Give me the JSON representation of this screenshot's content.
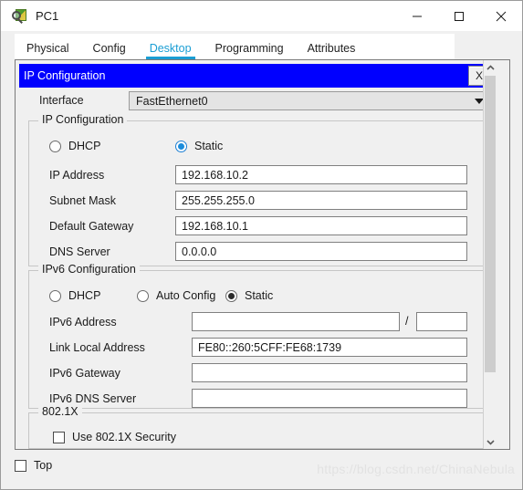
{
  "window": {
    "title": "PC1",
    "icon": "packet-tracer-icon",
    "controls": {
      "minimize": "minimize-icon",
      "maximize": "maximize-icon",
      "close": "close-icon"
    }
  },
  "tabs": [
    {
      "label": "Physical",
      "active": false
    },
    {
      "label": "Config",
      "active": false
    },
    {
      "label": "Desktop",
      "active": true
    },
    {
      "label": "Programming",
      "active": false
    },
    {
      "label": "Attributes",
      "active": false
    }
  ],
  "applet": {
    "caption": "IP Configuration",
    "close_label": "X",
    "caption_color": "#0000ff",
    "accent_color": "#1a9ed4"
  },
  "interface": {
    "label": "Interface",
    "value": "FastEthernet0",
    "arrow_icon": "chevron-down-icon"
  },
  "ipv4": {
    "group_title": "IP Configuration",
    "mode_options": [
      {
        "label": "DHCP",
        "selected": false
      },
      {
        "label": "Static",
        "selected": true
      }
    ],
    "fields": [
      {
        "label": "IP Address",
        "value": "192.168.10.2"
      },
      {
        "label": "Subnet Mask",
        "value": "255.255.255.0"
      },
      {
        "label": "Default Gateway",
        "value": "192.168.10.1"
      },
      {
        "label": "DNS Server",
        "value": "0.0.0.0"
      }
    ]
  },
  "ipv6": {
    "group_title": "IPv6 Configuration",
    "mode_options": [
      {
        "label": "DHCP",
        "selected": false
      },
      {
        "label": "Auto Config",
        "selected": false
      },
      {
        "label": "Static",
        "selected": true
      }
    ],
    "address": {
      "label": "IPv6 Address",
      "value": "",
      "separator": "/",
      "prefix": ""
    },
    "fields": [
      {
        "label": "Link Local Address",
        "value": "FE80::260:5CFF:FE68:1739"
      },
      {
        "label": "IPv6 Gateway",
        "value": ""
      },
      {
        "label": "IPv6 DNS Server",
        "value": ""
      }
    ]
  },
  "dot1x": {
    "group_title": "802.1X",
    "checkbox_label": "Use 802.1X Security",
    "checked": false
  },
  "bottom": {
    "top_checkbox_label": "Top",
    "top_checked": false
  },
  "scrollbar": {
    "up_icon": "chevron-up-icon",
    "down_icon": "chevron-down-icon"
  },
  "watermark": "https://blog.csdn.net/ChinaNebula"
}
